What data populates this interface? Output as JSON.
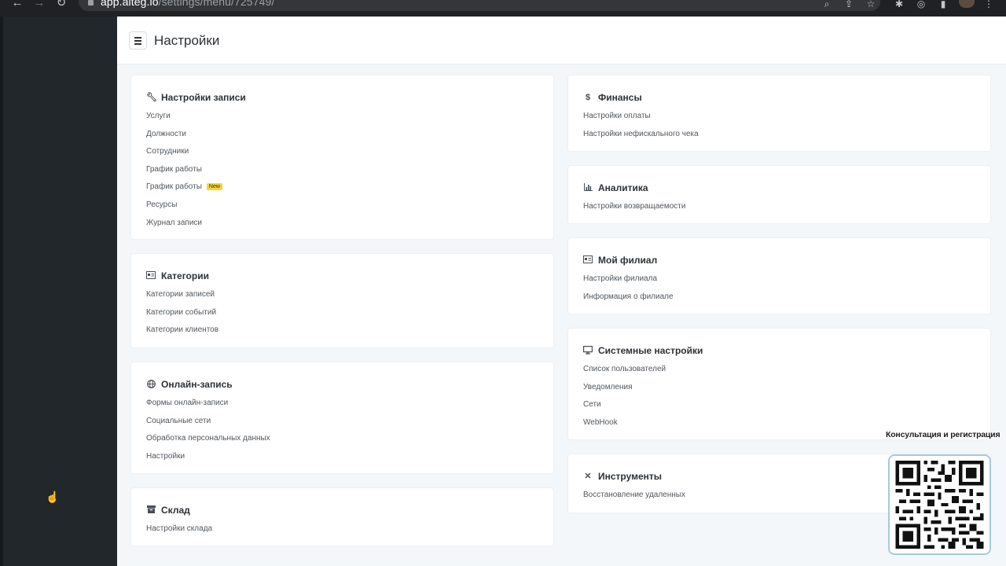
{
  "browser": {
    "url_host": "app.alteg.io",
    "url_path": "/settings/menu/725749/"
  },
  "header": {
    "title": "Настройки"
  },
  "left_cards": [
    {
      "title": "Настройки записи",
      "icon": "wrench-icon",
      "items": [
        {
          "label": "Услуги"
        },
        {
          "label": "Должности"
        },
        {
          "label": "Сотрудники"
        },
        {
          "label": "График работы"
        },
        {
          "label": "График работы",
          "badge": "New"
        },
        {
          "label": "Ресурсы"
        },
        {
          "label": "Журнал записи"
        }
      ]
    },
    {
      "title": "Категории",
      "icon": "id-card-icon",
      "items": [
        {
          "label": "Категории записей"
        },
        {
          "label": "Категории событий"
        },
        {
          "label": "Категории клиентов"
        }
      ]
    },
    {
      "title": "Онлайн-запись",
      "icon": "globe-icon",
      "items": [
        {
          "label": "Формы онлайн-записи"
        },
        {
          "label": "Социальные сети"
        },
        {
          "label": "Обработка персональных данных"
        },
        {
          "label": "Настройки"
        }
      ]
    },
    {
      "title": "Склад",
      "icon": "archive-box-icon",
      "items": [
        {
          "label": "Настройки склада"
        }
      ]
    }
  ],
  "right_cards": [
    {
      "title": "Финансы",
      "icon": "dollar-icon",
      "items": [
        {
          "label": "Настройки оплаты"
        },
        {
          "label": "Настройки нефискального чека"
        }
      ]
    },
    {
      "title": "Аналитика",
      "icon": "bar-chart-icon",
      "items": [
        {
          "label": "Настройки возвращаемости"
        }
      ]
    },
    {
      "title": "Мой филиал",
      "icon": "id-card-icon",
      "items": [
        {
          "label": "Настройки филиала"
        },
        {
          "label": "Информация о филиале"
        }
      ]
    },
    {
      "title": "Системные настройки",
      "icon": "monitor-icon",
      "items": [
        {
          "label": "Список пользователей"
        },
        {
          "label": "Уведомления"
        },
        {
          "label": "Сети"
        },
        {
          "label": "WebHook"
        }
      ]
    },
    {
      "title": "Инструменты",
      "icon": "tools-icon",
      "items": [
        {
          "label": "Восстановление удаленных"
        }
      ]
    }
  ],
  "promo": {
    "text": "Консультация и регистрация"
  },
  "colors": {
    "sidebar": "#22272b",
    "page_bg": "#f4f7f9",
    "badge": "#f8d43a",
    "qr_border": "#a7cad7"
  }
}
